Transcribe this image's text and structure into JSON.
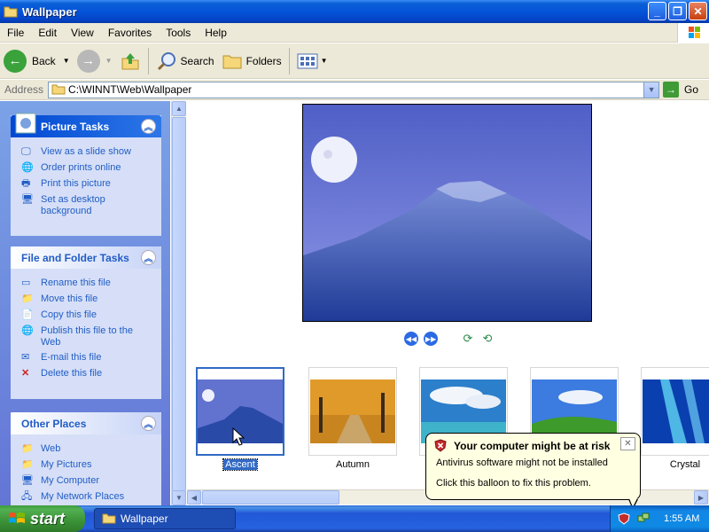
{
  "window": {
    "title": "Wallpaper"
  },
  "menu": [
    "File",
    "Edit",
    "View",
    "Favorites",
    "Tools",
    "Help"
  ],
  "toolbar": {
    "back": "Back",
    "search": "Search",
    "folders": "Folders"
  },
  "address": {
    "label": "Address",
    "value": "C:\\WINNT\\Web\\Wallpaper",
    "go": "Go"
  },
  "picture_tasks": {
    "title": "Picture Tasks",
    "items": [
      "View as a slide show",
      "Order prints online",
      "Print this picture",
      "Set as desktop background"
    ]
  },
  "file_tasks": {
    "title": "File and Folder Tasks",
    "items": [
      "Rename this file",
      "Move this file",
      "Copy this file",
      "Publish this file to the Web",
      "E-mail this file",
      "Delete this file"
    ]
  },
  "other_places": {
    "title": "Other Places",
    "items": [
      "Web",
      "My Pictures",
      "My Computer",
      "My Network Places"
    ]
  },
  "thumbnails": [
    "Ascent",
    "Autumn",
    "",
    "",
    "Crystal"
  ],
  "selected_thumbnail": "Ascent",
  "balloon": {
    "title": "Your computer might be at risk",
    "line1": "Antivirus software might not be installed",
    "line2": "Click this balloon to fix this problem."
  },
  "taskbar": {
    "start": "start",
    "window_item": "Wallpaper",
    "clock": "1:55 AM"
  }
}
